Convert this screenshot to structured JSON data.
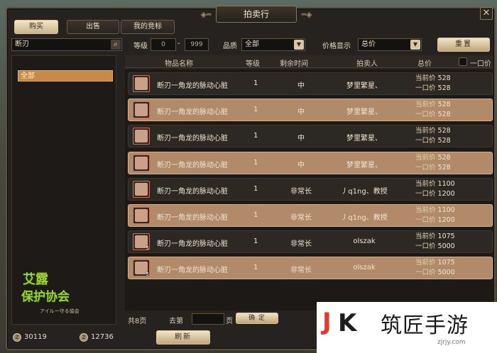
{
  "window": {
    "title": "拍卖行"
  },
  "tabs": [
    {
      "label": "购买",
      "active": true
    },
    {
      "label": "出售",
      "active": false
    },
    {
      "label": "我的竞标",
      "active": false
    }
  ],
  "filters": {
    "search_value": "断刃",
    "level_label": "等级",
    "level_min": "0",
    "level_sep": "-",
    "level_max": "999",
    "quality_label": "品质",
    "quality_value": "全部",
    "price_display_label": "价格显示",
    "price_display_value": "总价",
    "reset_label": "重置"
  },
  "categories": [
    "全部"
  ],
  "table": {
    "headers": {
      "name": "物品名称",
      "level": "等级",
      "time": "剩余时间",
      "seller": "拍卖人",
      "total": "总价",
      "buyout_only": "一口价"
    },
    "current_label": "当前价",
    "buyout_label": "一口价",
    "rows": [
      {
        "name": "断刃一角龙的脉动心脏",
        "qty": "",
        "level": "1",
        "time": "中",
        "seller": "梦里繁星、",
        "current": "528",
        "buyout": "528"
      },
      {
        "name": "断刃一角龙的脉动心脏",
        "qty": "",
        "level": "1",
        "time": "中",
        "seller": "梦里繁星、",
        "current": "528",
        "buyout": "528"
      },
      {
        "name": "断刃一角龙的脉动心脏",
        "qty": "",
        "level": "1",
        "time": "中",
        "seller": "梦里繁星、",
        "current": "528",
        "buyout": "528"
      },
      {
        "name": "断刃一角龙的脉动心脏",
        "qty": "",
        "level": "1",
        "time": "中",
        "seller": "梦里繁星、",
        "current": "528",
        "buyout": "528"
      },
      {
        "name": "断刃一角龙的脉动心脏",
        "qty": "",
        "level": "1",
        "time": "非常长",
        "seller": "丿q1ng、教授",
        "current": "1100",
        "buyout": "1200"
      },
      {
        "name": "断刃一角龙的脉动心脏",
        "qty": "",
        "level": "1",
        "time": "非常长",
        "seller": "丿q1ng、教授",
        "current": "1100",
        "buyout": "1200"
      },
      {
        "name": "断刃一角龙的脉动心脏",
        "qty": "5",
        "level": "1",
        "time": "非常长",
        "seller": "olszak",
        "current": "1075",
        "buyout": "5000"
      },
      {
        "name": "断刃一角龙的脉动心脏",
        "qty": "5",
        "level": "1",
        "time": "非常长",
        "seller": "olszak",
        "current": "1075",
        "buyout": "5000"
      }
    ]
  },
  "pager": {
    "total": "共8页",
    "goto": "去第",
    "page": "页",
    "confirm": "确 定"
  },
  "currency": [
    {
      "icon": "z-coin-icon",
      "value": "30119"
    },
    {
      "icon": "z-coin-icon",
      "value": "12736"
    }
  ],
  "refresh_label": "刷新",
  "logo": {
    "line1": "艾露",
    "line2": "保护协会",
    "sub": "アイルー守る協会"
  },
  "watermark": {
    "brand": "筑匠手游",
    "url": "zjrjy.com"
  }
}
